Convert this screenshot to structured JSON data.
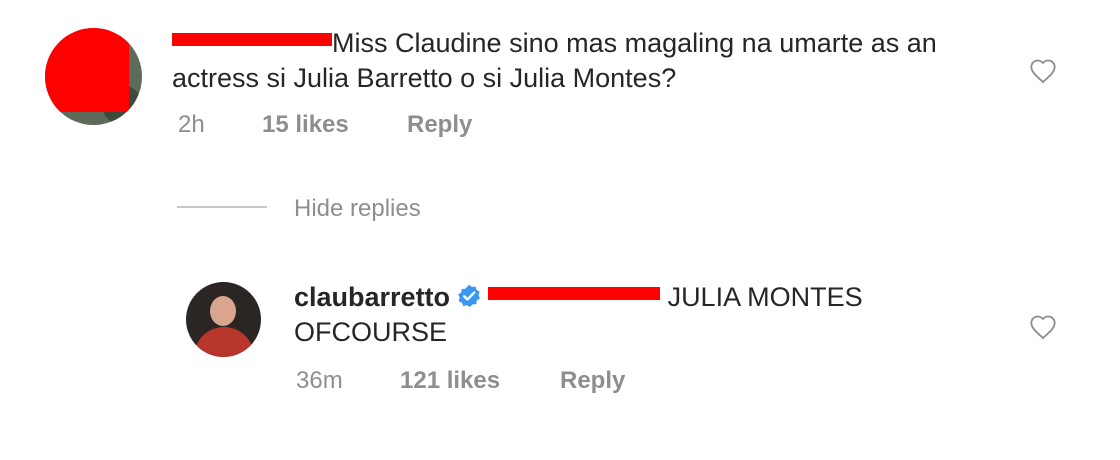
{
  "comment": {
    "text": "Miss Claudine sino mas magaling na umarte as an actress si Julia Barretto o si Julia Montes?",
    "time": "2h",
    "likes": "15 likes",
    "reply_label": "Reply"
  },
  "thread": {
    "hide_replies": "Hide replies"
  },
  "reply": {
    "username": "claubarretto",
    "text": "JULIA MONTES OFCOURSE",
    "time": "36m",
    "likes": "121 likes",
    "reply_label": "Reply",
    "verified_color": "#3897f0"
  },
  "colors": {
    "text": "#262626",
    "muted": "#8e8e8e",
    "redaction": "#ff0000"
  }
}
